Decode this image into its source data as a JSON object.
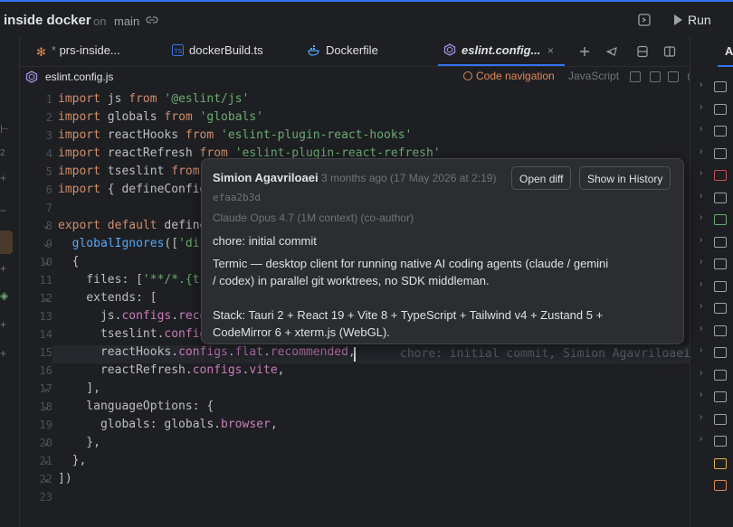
{
  "window": {
    "project": "inside docker",
    "on_label": "on",
    "branch": "main",
    "run_label": "Run"
  },
  "tabs": [
    {
      "label": "prs-inside...",
      "icon": "git-diff-icon",
      "modified": true
    },
    {
      "label": "dockerBuild.ts",
      "icon": "typescript-file-icon"
    },
    {
      "label": "Dockerfile",
      "icon": "docker-icon"
    },
    {
      "label": "eslint.config...",
      "icon": "eslint-icon",
      "active": true,
      "close": "×"
    }
  ],
  "breadcrumb": {
    "file": "eslint.config.js",
    "code_navigation": "Code navigation",
    "language": "JavaScript"
  },
  "editor": {
    "lines": [
      {
        "n": "1",
        "code": "import js from '@eslint/js'"
      },
      {
        "n": "2",
        "code": "import globals from 'globals'"
      },
      {
        "n": "3",
        "code": "import reactHooks from 'eslint-plugin-react-hooks'"
      },
      {
        "n": "4",
        "code": "import reactRefresh from 'eslint-plugin-react-refresh'"
      },
      {
        "n": "5",
        "code": "import tseslint from"
      },
      {
        "n": "6",
        "code": "import { defineConfig"
      },
      {
        "n": "7",
        "code": ""
      },
      {
        "n": "8",
        "code": "export default define"
      },
      {
        "n": "9",
        "code": "  globalIgnores(['dis"
      },
      {
        "n": "10",
        "code": "  {"
      },
      {
        "n": "11",
        "code": "    files: ['**/*.{ts"
      },
      {
        "n": "12",
        "code": "    extends: ["
      },
      {
        "n": "13",
        "code": "      js.configs.reco"
      },
      {
        "n": "14",
        "code": "      tseslint.config"
      },
      {
        "n": "15",
        "code": "      reactHooks.configs.flat.recommended,"
      },
      {
        "n": "16",
        "code": "      reactRefresh.configs.vite,"
      },
      {
        "n": "17",
        "code": "    ],"
      },
      {
        "n": "18",
        "code": "    languageOptions: {"
      },
      {
        "n": "19",
        "code": "      globals: globals.browser,"
      },
      {
        "n": "20",
        "code": "    },"
      },
      {
        "n": "21",
        "code": "  },"
      },
      {
        "n": "22",
        "code": "])"
      },
      {
        "n": "23",
        "code": ""
      }
    ],
    "inline_blame": "chore: initial commit, Simion Agavriloaei"
  },
  "blame_popup": {
    "author": "Simion Agavriloaei",
    "date": "3 months ago (17 May 2026 at 2:19)",
    "open_diff": "Open diff",
    "show_history": "Show in History",
    "hash": "efaa2b3d",
    "coauthor": "Claude Opus 4.7 (1M context) (co-author)",
    "subject": "chore: initial commit",
    "body_1": "Termic — desktop client for running native AI coding agents (claude / gemini / codex) in parallel git worktrees, no SDK middleman.",
    "body_2": "Stack: Tauri 2 + React 19 + Vite 8 + TypeScript + Tailwind v4 + Zustand 5 + CodeMirror 6 + xterm.js (WebGL)."
  },
  "right_panel": {
    "header": "A",
    "rows": 19
  },
  "left_strip": {
    "badge": "2"
  },
  "colors": {
    "accent": "#3574f0",
    "keyword": "#cf8e6d",
    "string": "#6aab73",
    "code_navigation": "#e08855"
  }
}
